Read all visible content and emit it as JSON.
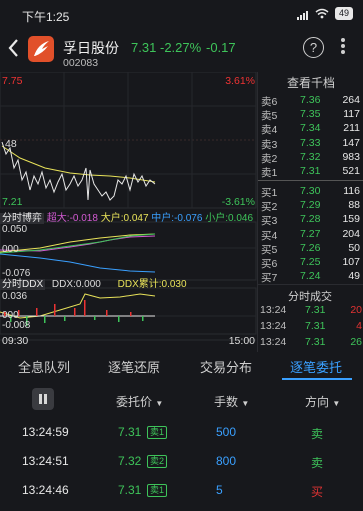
{
  "status_bar": {
    "time": "下午1:25",
    "battery": "49"
  },
  "header": {
    "back_icon": "chevron-left-icon",
    "stock_name": "孚日股份",
    "stock_code": "002083",
    "price": "7.31",
    "change_pct": "-2.27%",
    "change_abs": "-0.17",
    "help_label": "?"
  },
  "chart": {
    "price_high": "7.75",
    "pct_high": "3.61%",
    "price_low": "7.21",
    "pct_low": "-3.61%",
    "ref_price_partial": "48",
    "time_start": "09:30",
    "time_end": "15:00",
    "bidding": {
      "title": "分时博弈",
      "super_label": "超大:",
      "super_val": "-0.018",
      "large_label": "大户:",
      "large_val": "0.047",
      "mid_label": "中户:",
      "mid_val": "-0.076",
      "small_label": "小户:",
      "small_val": "0.046",
      "axis_top": "0.050",
      "axis_mid": "000",
      "axis_bottom": "-0.076"
    },
    "ddx": {
      "title": "分时DDX",
      "ddx_label": "DDX:",
      "ddx_val": "0.000",
      "ddx_cum_label": "DDX累计:",
      "ddx_cum_val": "0.030",
      "axis_top": "0.036",
      "axis_mid": "000",
      "axis_bottom": "-0.008"
    },
    "colors": {
      "red": "#e33333",
      "green": "#3ec45a",
      "yellow": "#e9e35a",
      "blue": "#3aa0ff",
      "magenta": "#d35ad3"
    }
  },
  "order_book": {
    "title": "查看千档",
    "asks": [
      {
        "label": "卖6",
        "price": "7.36",
        "volume": "264"
      },
      {
        "label": "卖5",
        "price": "7.35",
        "volume": "117"
      },
      {
        "label": "卖4",
        "price": "7.34",
        "volume": "211"
      },
      {
        "label": "卖3",
        "price": "7.33",
        "volume": "147"
      },
      {
        "label": "卖2",
        "price": "7.32",
        "volume": "983"
      },
      {
        "label": "卖1",
        "price": "7.31",
        "volume": "521"
      }
    ],
    "bids": [
      {
        "label": "买1",
        "price": "7.30",
        "volume": "116"
      },
      {
        "label": "买2",
        "price": "7.29",
        "volume": "88"
      },
      {
        "label": "买3",
        "price": "7.28",
        "volume": "159"
      },
      {
        "label": "买4",
        "price": "7.27",
        "volume": "204"
      },
      {
        "label": "买5",
        "price": "7.26",
        "volume": "50"
      },
      {
        "label": "买6",
        "price": "7.25",
        "volume": "107"
      },
      {
        "label": "买7",
        "price": "7.24",
        "volume": "49"
      }
    ],
    "ticks_title": "分时成交",
    "ticks": [
      {
        "time": "13:24",
        "price": "7.31",
        "volume": "20",
        "color": "#e33333"
      },
      {
        "time": "13:24",
        "price": "7.31",
        "volume": "4",
        "color": "#e33333"
      },
      {
        "time": "13:24",
        "price": "7.31",
        "volume": "26",
        "color": "#3ec45a"
      }
    ]
  },
  "tabs": [
    {
      "label": "全息队列"
    },
    {
      "label": "逐笔还原"
    },
    {
      "label": "交易分布"
    },
    {
      "label": "逐笔委托"
    }
  ],
  "table": {
    "headers": {
      "price": "委托价",
      "qty": "手数",
      "dir": "方向"
    },
    "rows": [
      {
        "time": "13:24:59",
        "price": "7.31",
        "tag": "卖1",
        "qty": "500",
        "direction": "卖"
      },
      {
        "time": "13:24:51",
        "price": "7.32",
        "tag": "卖2",
        "qty": "800",
        "direction": "卖"
      },
      {
        "time": "13:24:46",
        "price": "7.31",
        "tag": "卖1",
        "qty": "5",
        "direction": "买"
      }
    ]
  }
}
